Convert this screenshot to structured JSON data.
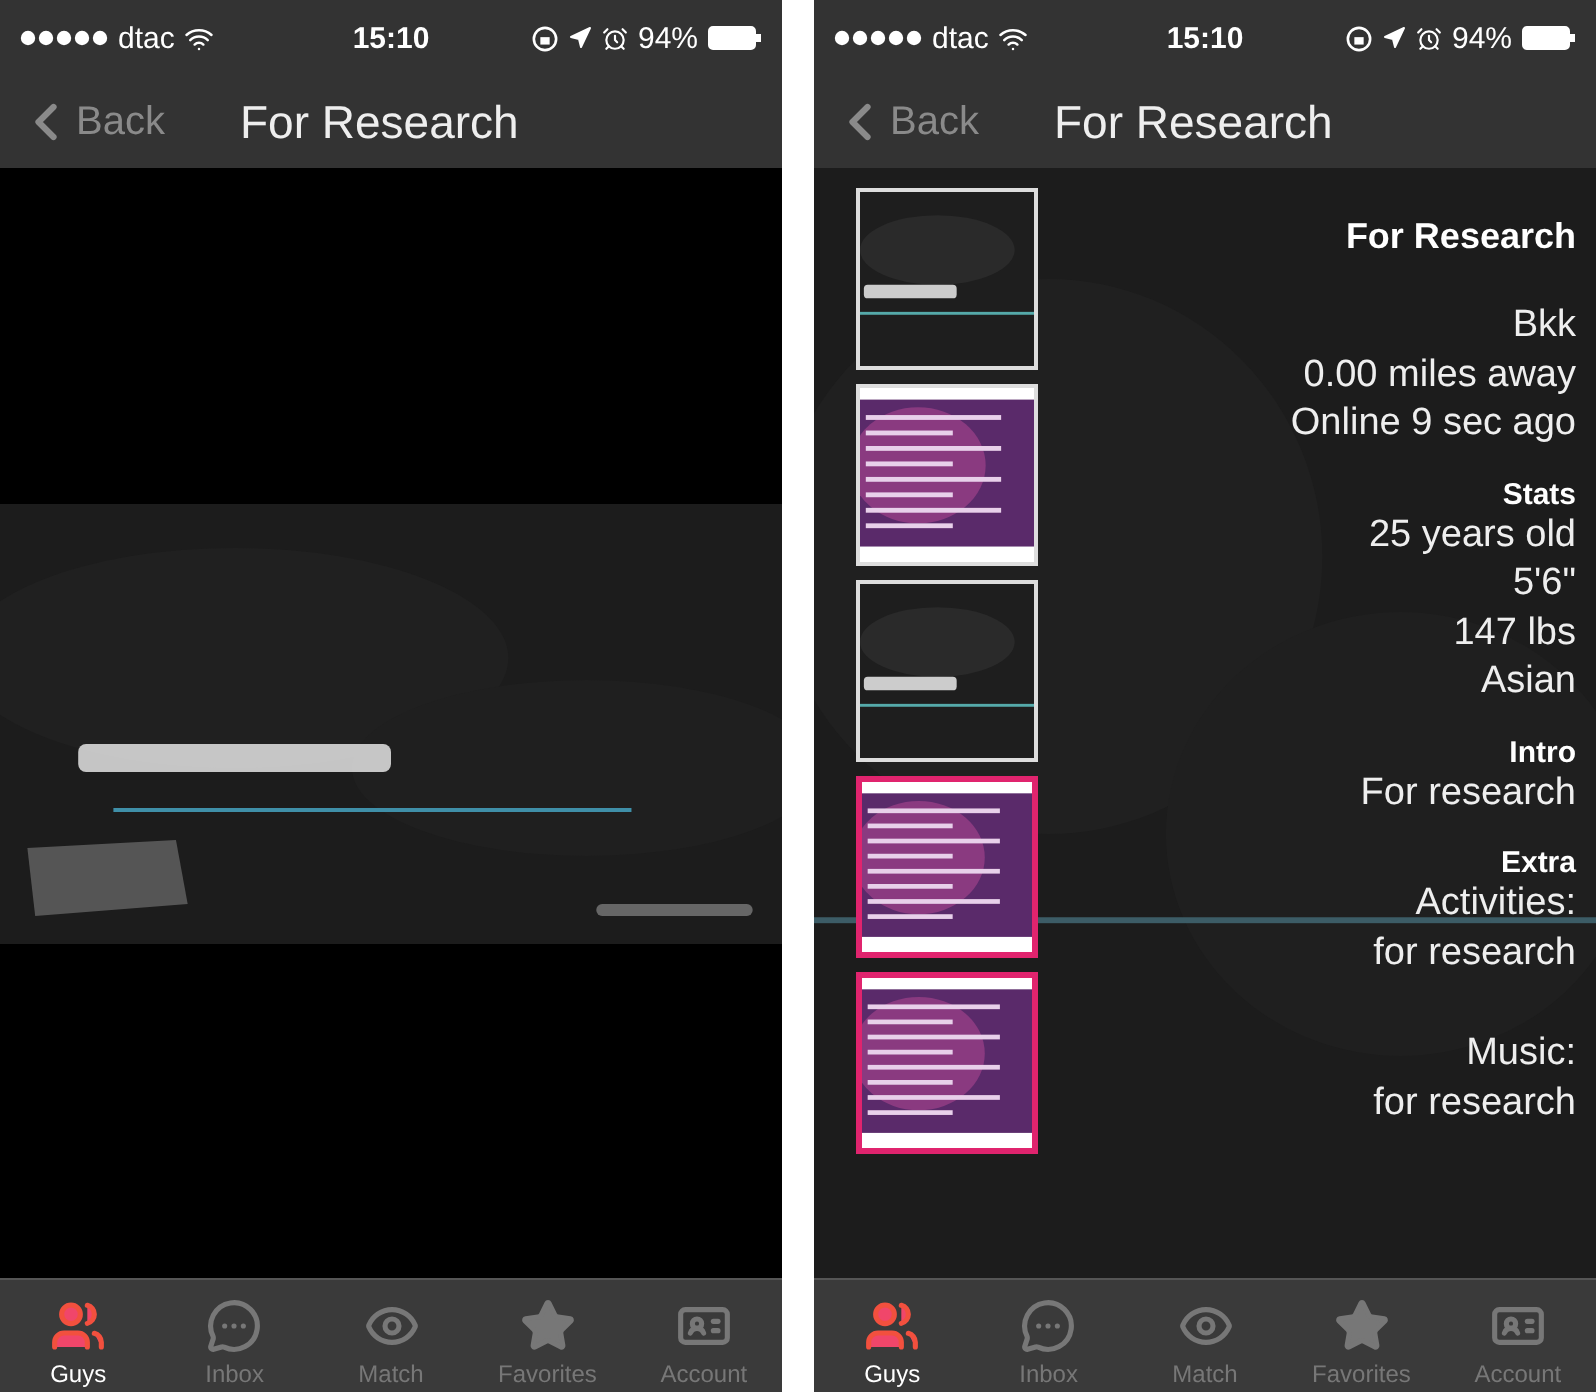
{
  "screens": [
    {
      "status_bar": {
        "carrier": "dtac",
        "time": "15:10",
        "battery": "94%"
      },
      "nav": {
        "back": "Back",
        "title": "For Research"
      },
      "tabs": [
        {
          "label": "Guys",
          "selected": true
        },
        {
          "label": "Inbox",
          "selected": false
        },
        {
          "label": "Match",
          "selected": false
        },
        {
          "label": "Favorites",
          "selected": false
        },
        {
          "label": "Account",
          "selected": false
        }
      ]
    },
    {
      "kind": "profile",
      "status_bar": {
        "carrier": "dtac",
        "time": "15:10",
        "battery": "94%"
      },
      "nav": {
        "back": "Back",
        "title": "For Research"
      },
      "photos": [
        {
          "kind": "dark",
          "selected": false
        },
        {
          "kind": "slide",
          "selected": false
        },
        {
          "kind": "dark",
          "selected": false
        },
        {
          "kind": "slide",
          "selected": true
        },
        {
          "kind": "slide",
          "selected": true
        }
      ],
      "profile": {
        "name": "For Research",
        "sections": [
          {
            "groups": [
              [
                "Bkk",
                "0.00 miles away",
                "Online 9 sec ago"
              ]
            ]
          },
          {
            "heading": "Stats",
            "groups": [
              [
                "25 years old",
                "5'6\"",
                "147 lbs",
                "Asian"
              ]
            ]
          },
          {
            "heading": "Intro",
            "groups": [
              [
                "For research"
              ]
            ]
          },
          {
            "heading": "Extra",
            "groups": [
              [
                "Activities:",
                "for research"
              ],
              [
                "Music:",
                "for research"
              ]
            ]
          }
        ]
      },
      "tabs": [
        {
          "label": "Guys",
          "selected": true
        },
        {
          "label": "Inbox",
          "selected": false
        },
        {
          "label": "Match",
          "selected": false
        },
        {
          "label": "Favorites",
          "selected": false
        },
        {
          "label": "Account",
          "selected": false
        }
      ]
    }
  ]
}
